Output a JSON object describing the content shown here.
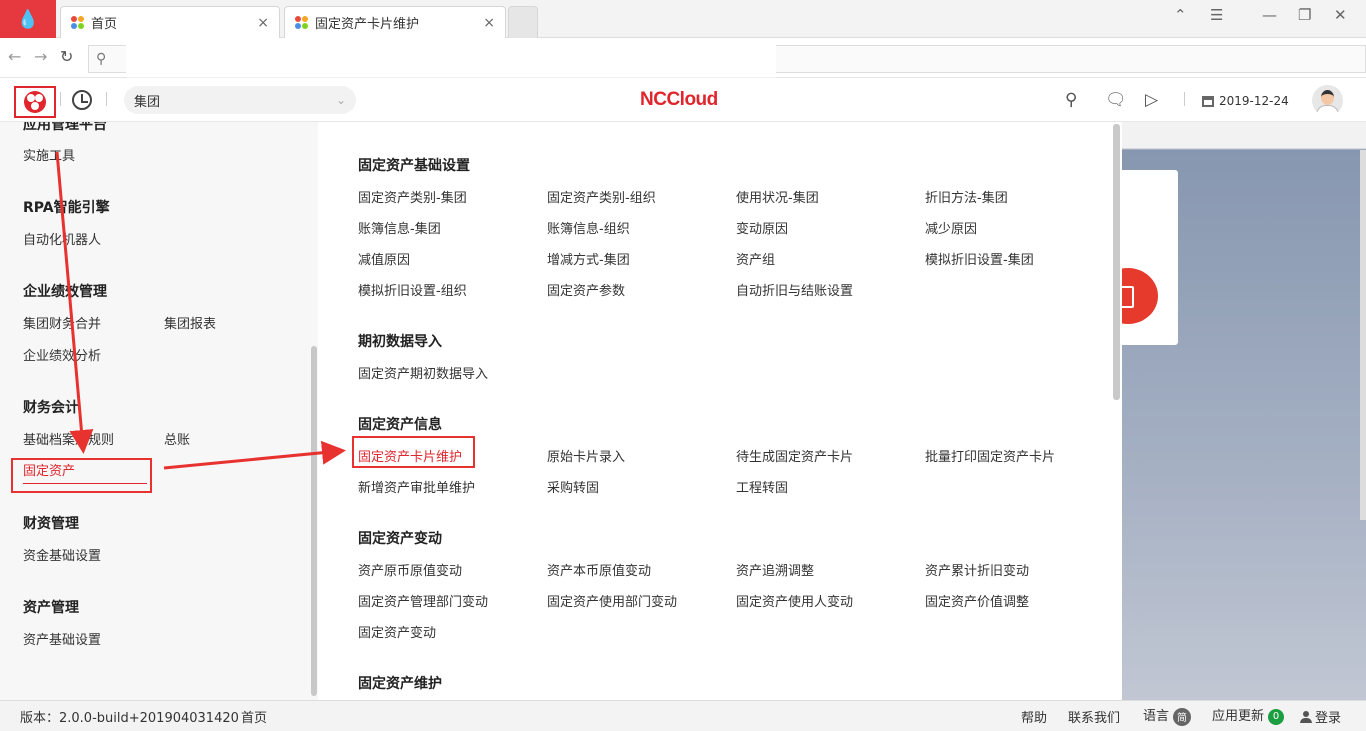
{
  "browser": {
    "tabs": [
      {
        "label": "首页",
        "close": "×"
      },
      {
        "label": "固定资产卡片维护",
        "close": "×"
      }
    ],
    "controls": {
      "back": "←",
      "forward": "→",
      "refresh": "↻",
      "search": "⚲"
    }
  },
  "header": {
    "org_select": "集团",
    "brand": "NCCloud",
    "date": "2019-12-24"
  },
  "left_menu": {
    "groups": [
      {
        "title": "应用管理平台",
        "items": [
          "实施工具"
        ]
      },
      {
        "title": "RPA智能引擎",
        "items": [
          "自动化机器人"
        ]
      },
      {
        "title": "企业绩效管理",
        "items": [
          "集团财务合并",
          "集团报表",
          "企业绩效分析"
        ]
      },
      {
        "title": "财务会计",
        "items": [
          "基础档案及规则",
          "总账",
          "固定资产"
        ]
      },
      {
        "title": "财资管理",
        "items": [
          "资金基础设置"
        ]
      },
      {
        "title": "资产管理",
        "items": [
          "资产基础设置"
        ]
      }
    ],
    "active": "固定资产"
  },
  "mega_menu": {
    "sections": [
      {
        "title": "固定资产基础设置",
        "items": [
          "固定资产类别-集团",
          "固定资产类别-组织",
          "使用状况-集团",
          "折旧方法-集团",
          "账簿信息-集团",
          "账簿信息-组织",
          "变动原因",
          "减少原因",
          "减值原因",
          "增减方式-集团",
          "资产组",
          "模拟折旧设置-集团",
          "模拟折旧设置-组织",
          "固定资产参数",
          "自动折旧与结账设置"
        ]
      },
      {
        "title": "期初数据导入",
        "items": [
          "固定资产期初数据导入"
        ]
      },
      {
        "title": "固定资产信息",
        "items": [
          "固定资产卡片维护",
          "原始卡片录入",
          "待生成固定资产卡片",
          "批量打印固定资产卡片",
          "新增资产审批单维护",
          "采购转固",
          "工程转固"
        ]
      },
      {
        "title": "固定资产变动",
        "items": [
          "资产原币原值变动",
          "资产本币原值变动",
          "资产追溯调整",
          "资产累计折旧变动",
          "固定资产管理部门变动",
          "固定资产使用部门变动",
          "固定资产使用人变动",
          "固定资产价值调整",
          "固定资产变动"
        ]
      },
      {
        "title": "固定资产维护",
        "items": []
      }
    ],
    "highlighted": "固定资产卡片维护"
  },
  "footer": {
    "version": "版本：2.0.0-build+201904031420",
    "home": "首页",
    "help": "帮助",
    "contact": "联系我们",
    "language": "语言",
    "language_badge": "简",
    "update": "应用更新",
    "update_count": "0",
    "login": "登录"
  },
  "colors": {
    "brand_red": "#e0262c",
    "annotation_red": "#e8322f"
  }
}
